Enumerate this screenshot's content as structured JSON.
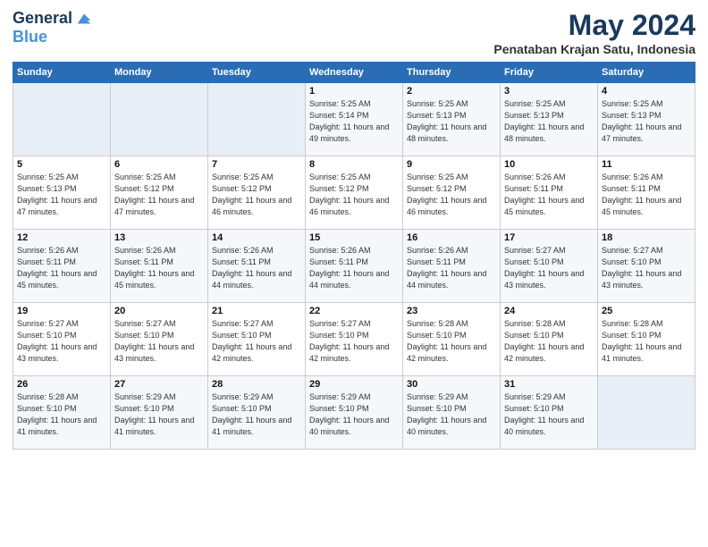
{
  "header": {
    "logo_line1": "General",
    "logo_line2": "Blue",
    "month": "May 2024",
    "location": "Penataban Krajan Satu, Indonesia"
  },
  "days_of_week": [
    "Sunday",
    "Monday",
    "Tuesday",
    "Wednesday",
    "Thursday",
    "Friday",
    "Saturday"
  ],
  "weeks": [
    [
      {
        "day": "",
        "sunrise": "",
        "sunset": "",
        "daylight": "",
        "empty": true
      },
      {
        "day": "",
        "sunrise": "",
        "sunset": "",
        "daylight": "",
        "empty": true
      },
      {
        "day": "",
        "sunrise": "",
        "sunset": "",
        "daylight": "",
        "empty": true
      },
      {
        "day": "1",
        "sunrise": "Sunrise: 5:25 AM",
        "sunset": "Sunset: 5:14 PM",
        "daylight": "Daylight: 11 hours and 49 minutes.",
        "empty": false
      },
      {
        "day": "2",
        "sunrise": "Sunrise: 5:25 AM",
        "sunset": "Sunset: 5:13 PM",
        "daylight": "Daylight: 11 hours and 48 minutes.",
        "empty": false
      },
      {
        "day": "3",
        "sunrise": "Sunrise: 5:25 AM",
        "sunset": "Sunset: 5:13 PM",
        "daylight": "Daylight: 11 hours and 48 minutes.",
        "empty": false
      },
      {
        "day": "4",
        "sunrise": "Sunrise: 5:25 AM",
        "sunset": "Sunset: 5:13 PM",
        "daylight": "Daylight: 11 hours and 47 minutes.",
        "empty": false
      }
    ],
    [
      {
        "day": "5",
        "sunrise": "Sunrise: 5:25 AM",
        "sunset": "Sunset: 5:13 PM",
        "daylight": "Daylight: 11 hours and 47 minutes.",
        "empty": false
      },
      {
        "day": "6",
        "sunrise": "Sunrise: 5:25 AM",
        "sunset": "Sunset: 5:12 PM",
        "daylight": "Daylight: 11 hours and 47 minutes.",
        "empty": false
      },
      {
        "day": "7",
        "sunrise": "Sunrise: 5:25 AM",
        "sunset": "Sunset: 5:12 PM",
        "daylight": "Daylight: 11 hours and 46 minutes.",
        "empty": false
      },
      {
        "day": "8",
        "sunrise": "Sunrise: 5:25 AM",
        "sunset": "Sunset: 5:12 PM",
        "daylight": "Daylight: 11 hours and 46 minutes.",
        "empty": false
      },
      {
        "day": "9",
        "sunrise": "Sunrise: 5:25 AM",
        "sunset": "Sunset: 5:12 PM",
        "daylight": "Daylight: 11 hours and 46 minutes.",
        "empty": false
      },
      {
        "day": "10",
        "sunrise": "Sunrise: 5:26 AM",
        "sunset": "Sunset: 5:11 PM",
        "daylight": "Daylight: 11 hours and 45 minutes.",
        "empty": false
      },
      {
        "day": "11",
        "sunrise": "Sunrise: 5:26 AM",
        "sunset": "Sunset: 5:11 PM",
        "daylight": "Daylight: 11 hours and 45 minutes.",
        "empty": false
      }
    ],
    [
      {
        "day": "12",
        "sunrise": "Sunrise: 5:26 AM",
        "sunset": "Sunset: 5:11 PM",
        "daylight": "Daylight: 11 hours and 45 minutes.",
        "empty": false
      },
      {
        "day": "13",
        "sunrise": "Sunrise: 5:26 AM",
        "sunset": "Sunset: 5:11 PM",
        "daylight": "Daylight: 11 hours and 45 minutes.",
        "empty": false
      },
      {
        "day": "14",
        "sunrise": "Sunrise: 5:26 AM",
        "sunset": "Sunset: 5:11 PM",
        "daylight": "Daylight: 11 hours and 44 minutes.",
        "empty": false
      },
      {
        "day": "15",
        "sunrise": "Sunrise: 5:26 AM",
        "sunset": "Sunset: 5:11 PM",
        "daylight": "Daylight: 11 hours and 44 minutes.",
        "empty": false
      },
      {
        "day": "16",
        "sunrise": "Sunrise: 5:26 AM",
        "sunset": "Sunset: 5:11 PM",
        "daylight": "Daylight: 11 hours and 44 minutes.",
        "empty": false
      },
      {
        "day": "17",
        "sunrise": "Sunrise: 5:27 AM",
        "sunset": "Sunset: 5:10 PM",
        "daylight": "Daylight: 11 hours and 43 minutes.",
        "empty": false
      },
      {
        "day": "18",
        "sunrise": "Sunrise: 5:27 AM",
        "sunset": "Sunset: 5:10 PM",
        "daylight": "Daylight: 11 hours and 43 minutes.",
        "empty": false
      }
    ],
    [
      {
        "day": "19",
        "sunrise": "Sunrise: 5:27 AM",
        "sunset": "Sunset: 5:10 PM",
        "daylight": "Daylight: 11 hours and 43 minutes.",
        "empty": false
      },
      {
        "day": "20",
        "sunrise": "Sunrise: 5:27 AM",
        "sunset": "Sunset: 5:10 PM",
        "daylight": "Daylight: 11 hours and 43 minutes.",
        "empty": false
      },
      {
        "day": "21",
        "sunrise": "Sunrise: 5:27 AM",
        "sunset": "Sunset: 5:10 PM",
        "daylight": "Daylight: 11 hours and 42 minutes.",
        "empty": false
      },
      {
        "day": "22",
        "sunrise": "Sunrise: 5:27 AM",
        "sunset": "Sunset: 5:10 PM",
        "daylight": "Daylight: 11 hours and 42 minutes.",
        "empty": false
      },
      {
        "day": "23",
        "sunrise": "Sunrise: 5:28 AM",
        "sunset": "Sunset: 5:10 PM",
        "daylight": "Daylight: 11 hours and 42 minutes.",
        "empty": false
      },
      {
        "day": "24",
        "sunrise": "Sunrise: 5:28 AM",
        "sunset": "Sunset: 5:10 PM",
        "daylight": "Daylight: 11 hours and 42 minutes.",
        "empty": false
      },
      {
        "day": "25",
        "sunrise": "Sunrise: 5:28 AM",
        "sunset": "Sunset: 5:10 PM",
        "daylight": "Daylight: 11 hours and 41 minutes.",
        "empty": false
      }
    ],
    [
      {
        "day": "26",
        "sunrise": "Sunrise: 5:28 AM",
        "sunset": "Sunset: 5:10 PM",
        "daylight": "Daylight: 11 hours and 41 minutes.",
        "empty": false
      },
      {
        "day": "27",
        "sunrise": "Sunrise: 5:29 AM",
        "sunset": "Sunset: 5:10 PM",
        "daylight": "Daylight: 11 hours and 41 minutes.",
        "empty": false
      },
      {
        "day": "28",
        "sunrise": "Sunrise: 5:29 AM",
        "sunset": "Sunset: 5:10 PM",
        "daylight": "Daylight: 11 hours and 41 minutes.",
        "empty": false
      },
      {
        "day": "29",
        "sunrise": "Sunrise: 5:29 AM",
        "sunset": "Sunset: 5:10 PM",
        "daylight": "Daylight: 11 hours and 40 minutes.",
        "empty": false
      },
      {
        "day": "30",
        "sunrise": "Sunrise: 5:29 AM",
        "sunset": "Sunset: 5:10 PM",
        "daylight": "Daylight: 11 hours and 40 minutes.",
        "empty": false
      },
      {
        "day": "31",
        "sunrise": "Sunrise: 5:29 AM",
        "sunset": "Sunset: 5:10 PM",
        "daylight": "Daylight: 11 hours and 40 minutes.",
        "empty": false
      },
      {
        "day": "",
        "sunrise": "",
        "sunset": "",
        "daylight": "",
        "empty": true
      }
    ]
  ]
}
